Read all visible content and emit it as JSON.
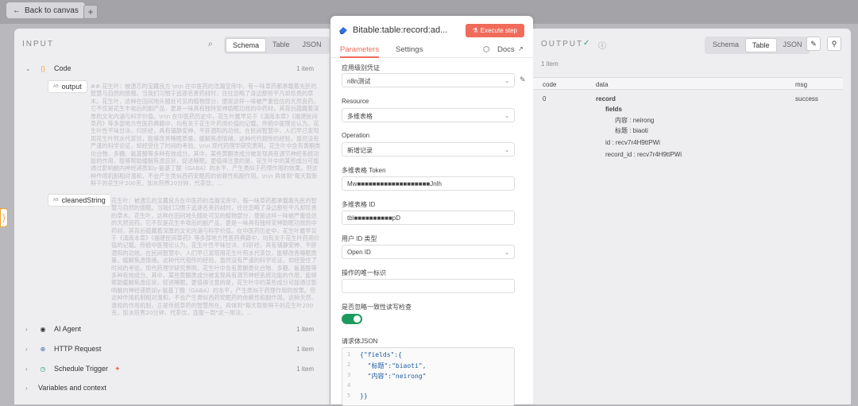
{
  "topbar": {
    "back_label": "Back to canvas",
    "plus_label": "+"
  },
  "input": {
    "title": "INPUT",
    "seg": [
      "Schema",
      "Table",
      "JSON"
    ],
    "code_node": {
      "label": "Code",
      "items": "1 item"
    },
    "output_field": "output",
    "output_text": "## 花生叶：被遗忘的宝藏良方 \\n\\n 在中医药的浩瀚宝库中，有一味草药都承载着先民的智慧与自然的馈赠。当我们习惯于追逐名贵药材时，往往忽略了身边那些平凡却珍贵的草木。花生叶，这种在田间地头随处可见的植物部分，便是这样一味被严重低估的天然良药。它不仅是花生丰收后的副产品，更是一味具有独特安神助眠功效的中药材。其背后蕴藏着深厚的文化内涵与科学价值。\\n\\n 在中医药历史中，花生叶最早见于《滇南本草》《福建民间草药》等多部地方性医药典籍中，均有关于花生叶药用价值的记载。传统中医理论认为，花生叶性平味甘淡，归肝经，具有镇静安神、平肝潜阳的功效。在民间智慧中，人们早已发现用花生叶煎水代茶饮，能够改善睡眠质量，缓解焦虑情绪。这种代代相传的经验，虽然没有严谨的科学论证，却经受住了时间的考验。\\n\\n 现代药理学研究表明，花生叶中含有黄酮类化合物、多糖、氨基酸等多种有效成分。其中，某些黄酮类成分被发现具有调节神经系统功能的作用，能够帮助缓解焦虑症状，促进睡眠。更值得注意的是，花生叶中的某些成分可能通过影响脑内神经递质如γ-氨基丁酸（GABA）的水平，产生类似于药理作用的效果。但这种作用机制相对温和，不会产生类似西药安眠药的依赖性和副作用。\\n\\n 具体到\"每天取新鲜干的花生叶200克，加水煎煮20分钟，代茶饮，...",
    "cleaned_field": "cleanedString",
    "cleaned_text": "花生叶：被遗忘的宝藏良方在中医药的浩瀚宝库中，每一味草药都承载着先民的智慧与自然的馈赠。当我们习惯于追逐名贵药材时，往往忽略了身边那些平凡却珍贵的草木。花生叶，这种在田间地头随处可见的植物部分，便是这样一味被严重低估的天然良药。它不仅是花生丰收后的副产品，更是一味具有独特安神助眠功效的中药材，其背后蕴藏着深厚的文化内涵与科学价值。在中医药历史中，花生叶最早见于《滇南本草》《福建民间草药》等多部地方性医药典籍中，均有关于花生叶药用价值的记载。传统中医理论认为，花生叶性平味甘淡，归肝经，具有镇静安神、平肝潜阳的功效。在民间智慧中，人们早已发现用花生叶煎水代茶饮，能够改善睡眠质量，缓解焦虑情绪。这种代代相传的经验，虽然没有严谨的科学论证，却经受住了时间的考验。现代药理学研究表明，花生叶中含有黄酮类化合物、多糖、氨基酸等多种有效成分。其中，某些黄酮类成分被发现具有调节神经系统功能的作用，能够帮助缓解焦虑症状，促进睡眠。更值得注意的是，花生叶中的某些成分可能通过影响脑内神经递质如γ-氨基丁酸（GABA）的水平，产生类似于药理作用的效果。但这种作用机制相对温和，不会产生类似西药安眠药的依赖性和副作用。这种天然、温和的作用机制，正是传统草药的智慧所在。具体到\"每天取新鲜干的花生叶200克，加水煎煮20分钟，代茶饮，连服一周\"这一用法，...",
    "others": [
      {
        "label": "AI Agent",
        "items": "1 item"
      },
      {
        "label": "HTTP Request",
        "items": "1 item"
      },
      {
        "label": "Schedule Trigger",
        "items": "1 item"
      }
    ],
    "vars": "Variables and context"
  },
  "modal": {
    "title": "Bitable:table:record:ad...",
    "execute": "Execute step",
    "tabs": {
      "params": "Parameters",
      "settings": "Settings",
      "docs": "Docs"
    },
    "fields": {
      "cred_label": "应用级别凭证",
      "cred_value": "n8n测试",
      "resource_label": "Resource",
      "resource_value": "多维表格",
      "op_label": "Operation",
      "op_value": "新增记录",
      "token_label": "多维表格 Token",
      "token_value": "Mw■■■■■■■■■■■■■■■■■■■Jnlh",
      "id_label": "多维表格 ID",
      "id_value": "tbl■■■■■■■■■■pD",
      "usertype_label": "用户 ID 类型",
      "usertype_value": "Open ID",
      "uid_label": "操作的唯一标识",
      "uid_value": "",
      "ignore_label": "是否忽略一致性读写检查",
      "json_label": "请求体JSON",
      "json_lines": [
        "{\"fields\":{",
        "  \"标题\":\"biaoti\",",
        "  \"内容\":\"neirong\"",
        "",
        "}}"
      ]
    }
  },
  "output": {
    "title": "OUTPUT",
    "seg": [
      "Schema",
      "Table",
      "JSON"
    ],
    "count": "1 item",
    "headers": [
      "code",
      "data",
      "msg"
    ],
    "code": "0",
    "msg": "success",
    "data": {
      "record": "record",
      "fields": "fields",
      "neirong": "内容 : neirong",
      "biaoti": "标题 : biaoti",
      "id": "id : recv7r4H9ttPWi",
      "record_id": "record_id : recv7r4H9ttPWi"
    }
  }
}
